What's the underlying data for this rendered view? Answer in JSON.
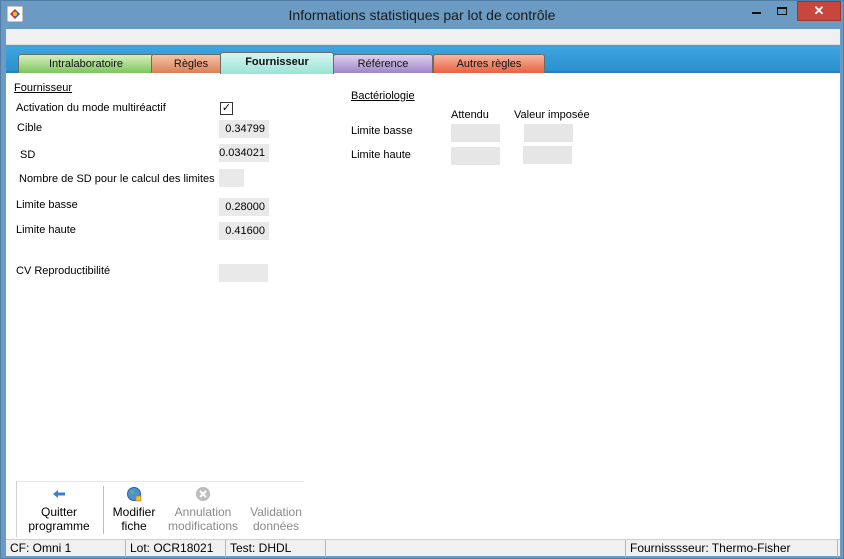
{
  "window": {
    "title": "Informations statistiques par lot de contrôle"
  },
  "colors": {
    "titlebar": "#6b9bc3",
    "tabstrip": "#3fa6e0",
    "close": "#c7463e"
  },
  "tabs": [
    {
      "label": "Intralaboratoire"
    },
    {
      "label": "Règles"
    },
    {
      "label": "Fournisseur"
    },
    {
      "label": "Référence"
    },
    {
      "label": "Autres règles"
    }
  ],
  "active_tab": "Fournisseur",
  "fournisseur": {
    "section_title": "Fournisseur",
    "activation_label": "Activation du mode multiréactif",
    "activation_checked": true,
    "activation_mark": "✓",
    "cible_label": "Cible",
    "cible_value": "0.34799",
    "sd_label": "SD",
    "sd_value": "0.034021",
    "nb_sd_label": "Nombre de SD pour le calcul des limites",
    "nb_sd_value": "",
    "limite_basse_label": "Limite basse",
    "limite_basse_value": "0.28000",
    "limite_haute_label": "Limite haute",
    "limite_haute_value": "0.41600",
    "cv_label": "CV Reproductibilité",
    "cv_value": ""
  },
  "bacteriologie": {
    "section_title": "Bactériologie",
    "col_attendu": "Attendu",
    "col_valeur_imposee": "Valeur imposée",
    "limite_basse_label": "Limite basse",
    "limite_haute_label": "Limite haute"
  },
  "toolbar": {
    "quit_line1": "Quitter",
    "quit_line2": "programme",
    "modify_line1": "Modifier",
    "modify_line2": "fiche",
    "cancel_line1": "Annulation",
    "cancel_line2": "modifications",
    "validate_line1": "Validation",
    "validate_line2": "données"
  },
  "status": {
    "cf": "CF: Omni 1",
    "lot": "Lot: OCR18021",
    "test": "Test: DHDL",
    "fournisseur": "Fournisssseur: Thermo-Fisher"
  }
}
